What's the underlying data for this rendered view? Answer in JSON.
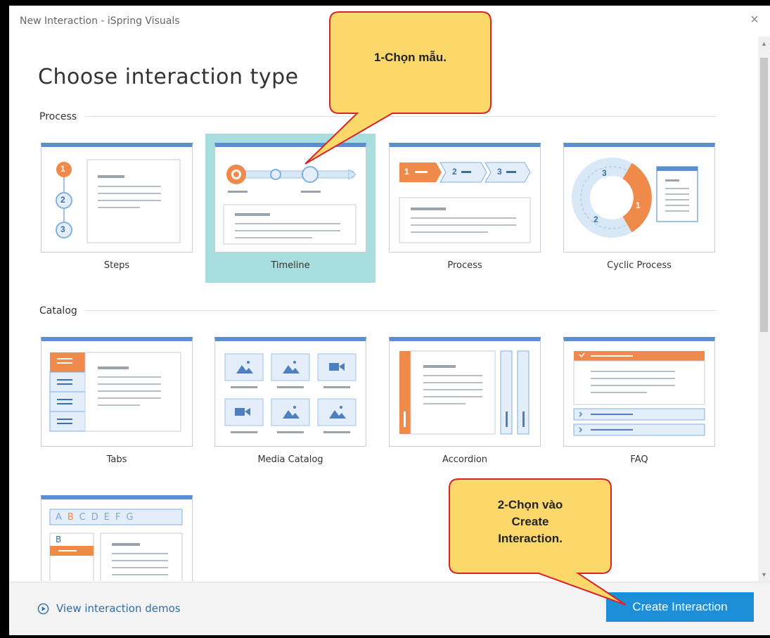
{
  "window": {
    "title": "New Interaction - iSpring Visuals",
    "close_glyph": "×"
  },
  "heading": "Choose interaction type",
  "sections": [
    {
      "label": "Process"
    },
    {
      "label": "Catalog"
    }
  ],
  "tiles": {
    "steps": "Steps",
    "timeline": "Timeline",
    "process": "Process",
    "cyclic": "Cyclic Process",
    "tabs": "Tabs",
    "media": "Media Catalog",
    "accordion": "Accordion",
    "faq": "FAQ"
  },
  "thumb_text": {
    "steps_nums": [
      "1",
      "2",
      "3"
    ],
    "process_nums": [
      "1",
      "2",
      "3"
    ],
    "cyclic_nums": [
      "3",
      "2",
      "1"
    ],
    "glossary_letters": [
      "A",
      "B",
      "C",
      "D",
      "E",
      "F",
      "G"
    ],
    "glossary_active": "B"
  },
  "selected_tile": "Timeline",
  "footer": {
    "demos_link": "View interaction demos",
    "create_button": "Create Interaction"
  },
  "annotations": {
    "callout1": "1-Chọn mẫu.",
    "callout2_lines": [
      "2-Chọn vào",
      "Create",
      "Interaction."
    ]
  },
  "colors": {
    "accent_blue": "#5b8fcf",
    "orange": "#f08a4b",
    "selected_bg": "#a9dede",
    "button_blue": "#1d8fd8",
    "callout_fill": "#fcd86a",
    "callout_stroke": "#d6262b"
  },
  "icons": {
    "scroll_up": "▲",
    "scroll_down": "▼",
    "demos": "play-circle-icon"
  }
}
